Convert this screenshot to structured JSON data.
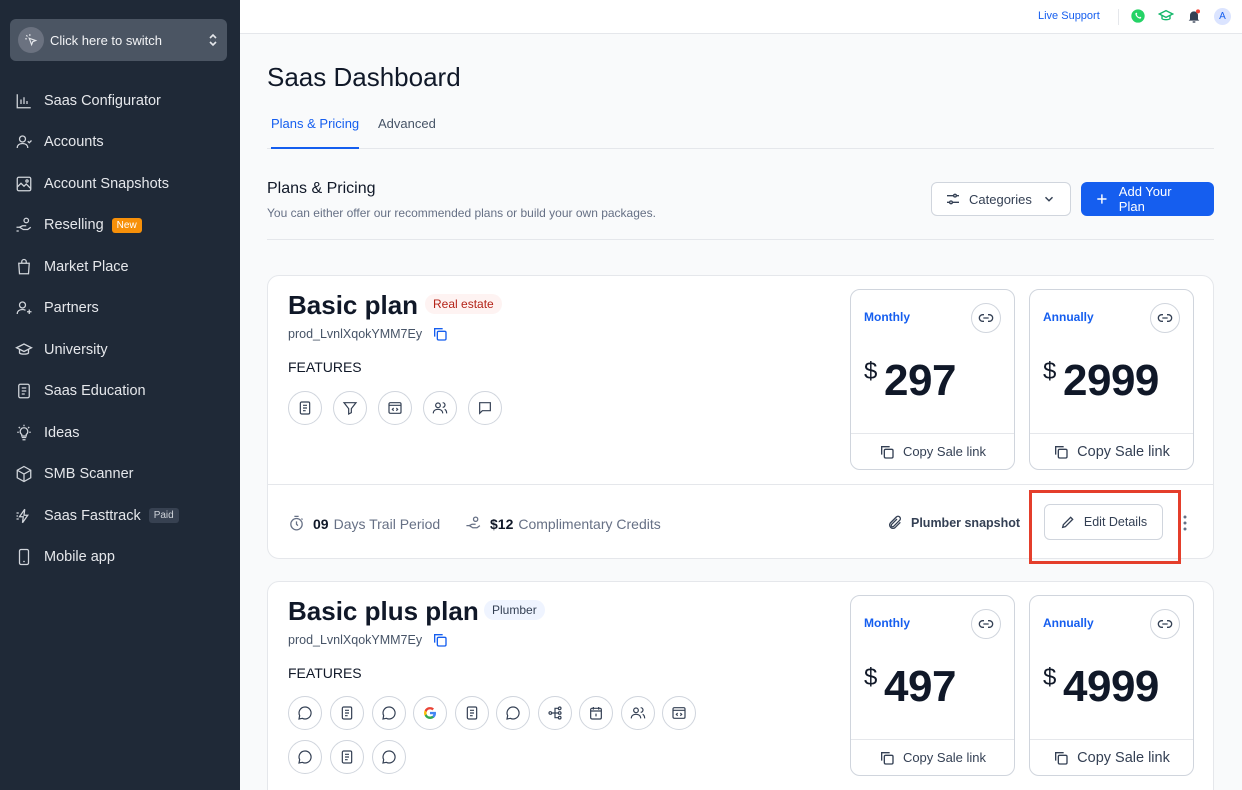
{
  "sidebar": {
    "switcher_label": "Click here to switch",
    "items": [
      {
        "label": "Saas Configurator",
        "icon": "chart-icon"
      },
      {
        "label": "Accounts",
        "icon": "user-icon"
      },
      {
        "label": "Account Snapshots",
        "icon": "snapshot-icon"
      },
      {
        "label": "Reselling",
        "icon": "hand-coin-icon",
        "badge": "New"
      },
      {
        "label": "Market Place",
        "icon": "shopping-bag-icon"
      },
      {
        "label": "Partners",
        "icon": "user-plus-icon"
      },
      {
        "label": "University",
        "icon": "graduation-cap-icon"
      },
      {
        "label": "Saas Education",
        "icon": "book-icon"
      },
      {
        "label": "Ideas",
        "icon": "lightbulb-icon"
      },
      {
        "label": "SMB Scanner",
        "icon": "cube-icon"
      },
      {
        "label": "Saas Fasttrack",
        "icon": "fast-icon",
        "badge": "Paid"
      },
      {
        "label": "Mobile app",
        "icon": "phone-icon"
      }
    ]
  },
  "topbar": {
    "live_support": "Live Support",
    "avatar_initial": "A",
    "colors": {
      "accent": "#155eef",
      "whatsapp": "#25d366",
      "cap": "#12b76a",
      "bell": "#344054",
      "notification_dot": "#f04438"
    }
  },
  "main": {
    "title": "Saas Dashboard",
    "tabs": [
      "Plans & Pricing",
      "Advanced"
    ],
    "section_title": "Plans & Pricing",
    "section_subtitle": "You can either offer our recommended plans or build your own packages.",
    "categories_label": "Categories",
    "add_plan_label": "Add Your Plan"
  },
  "plans": [
    {
      "name": "Basic plan",
      "tag": "Real estate",
      "product_id": "prod_LvnlXqokYMM7Ey",
      "features_label": "FEATURES",
      "feature_icons": [
        "document-icon",
        "funnel-icon",
        "code-window-icon",
        "users-icon",
        "chat-icon"
      ],
      "monthly": {
        "label": "Monthly",
        "currency": "$",
        "amount": "297",
        "copy_label": "Copy Sale link"
      },
      "annually": {
        "label": "Annually",
        "currency": "$",
        "amount": "2999",
        "copy_label": "Copy Sale link"
      },
      "trial_days": "09",
      "trial_label": "Days Trail Period",
      "credits": "$12",
      "credits_label": "Complimentary Credits",
      "snapshot": "Plumber snapshot",
      "edit_label": "Edit Details"
    },
    {
      "name": "Basic plus plan",
      "tag": "Plumber",
      "product_id": "prod_LvnlXqokYMM7Ey",
      "features_label": "FEATURES",
      "feature_icons": [
        "message-dots-icon",
        "document-icon",
        "chat-icon",
        "google-icon",
        "document-icon",
        "chat-icon",
        "workflow-icon",
        "calendar-icon",
        "users-icon",
        "code-window-icon",
        "message-dots-icon",
        "document-icon",
        "chat-icon"
      ],
      "monthly": {
        "label": "Monthly",
        "currency": "$",
        "amount": "497",
        "copy_label": "Copy Sale link"
      },
      "annually": {
        "label": "Annually",
        "currency": "$",
        "amount": "4999",
        "copy_label": "Copy Sale link"
      }
    }
  ]
}
